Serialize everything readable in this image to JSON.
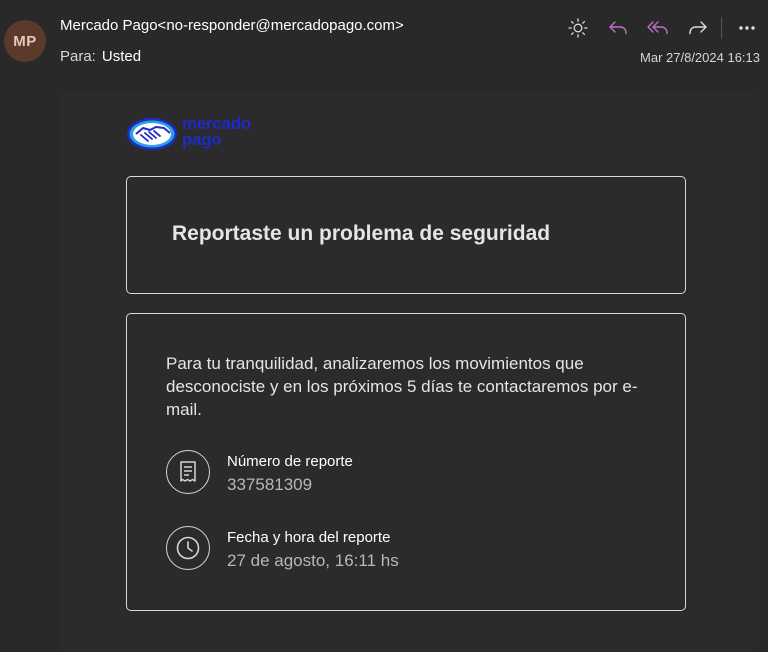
{
  "header": {
    "avatar_initials": "MP",
    "sender": "Mercado Pago<no-responder@mercadopago.com>",
    "to_label": "Para:",
    "to_value": "Usted",
    "date": "Mar 27/8/2024 16:13",
    "actions": [
      {
        "icon": "sun-icon",
        "label": "Switch background"
      },
      {
        "icon": "reply-icon",
        "label": "Reply"
      },
      {
        "icon": "reply-all-icon",
        "label": "Reply all"
      },
      {
        "icon": "forward-icon",
        "label": "Forward"
      },
      {
        "icon": "more-icon",
        "label": "More actions"
      }
    ],
    "colors": {
      "reply_accent": "#c06fc9",
      "avatar_bg": "#5a3a2a"
    }
  },
  "email": {
    "logo_line1": "mercado",
    "logo_line2": "pago",
    "title": "Reportaste un problema de seguridad",
    "paragraph": "Para tu tranquilidad, analizaremos los movimientos que desconociste y en los próximos 5 días te contactaremos por e-mail.",
    "report_number_label": "Número de reporte",
    "report_number_value": "337581309",
    "report_date_label": "Fecha y hora del reporte",
    "report_date_value": "27 de agosto, 16:11 hs",
    "colors": {
      "logo_blue": "#1e2bc7",
      "logo_light": "#2ea0e0"
    }
  }
}
